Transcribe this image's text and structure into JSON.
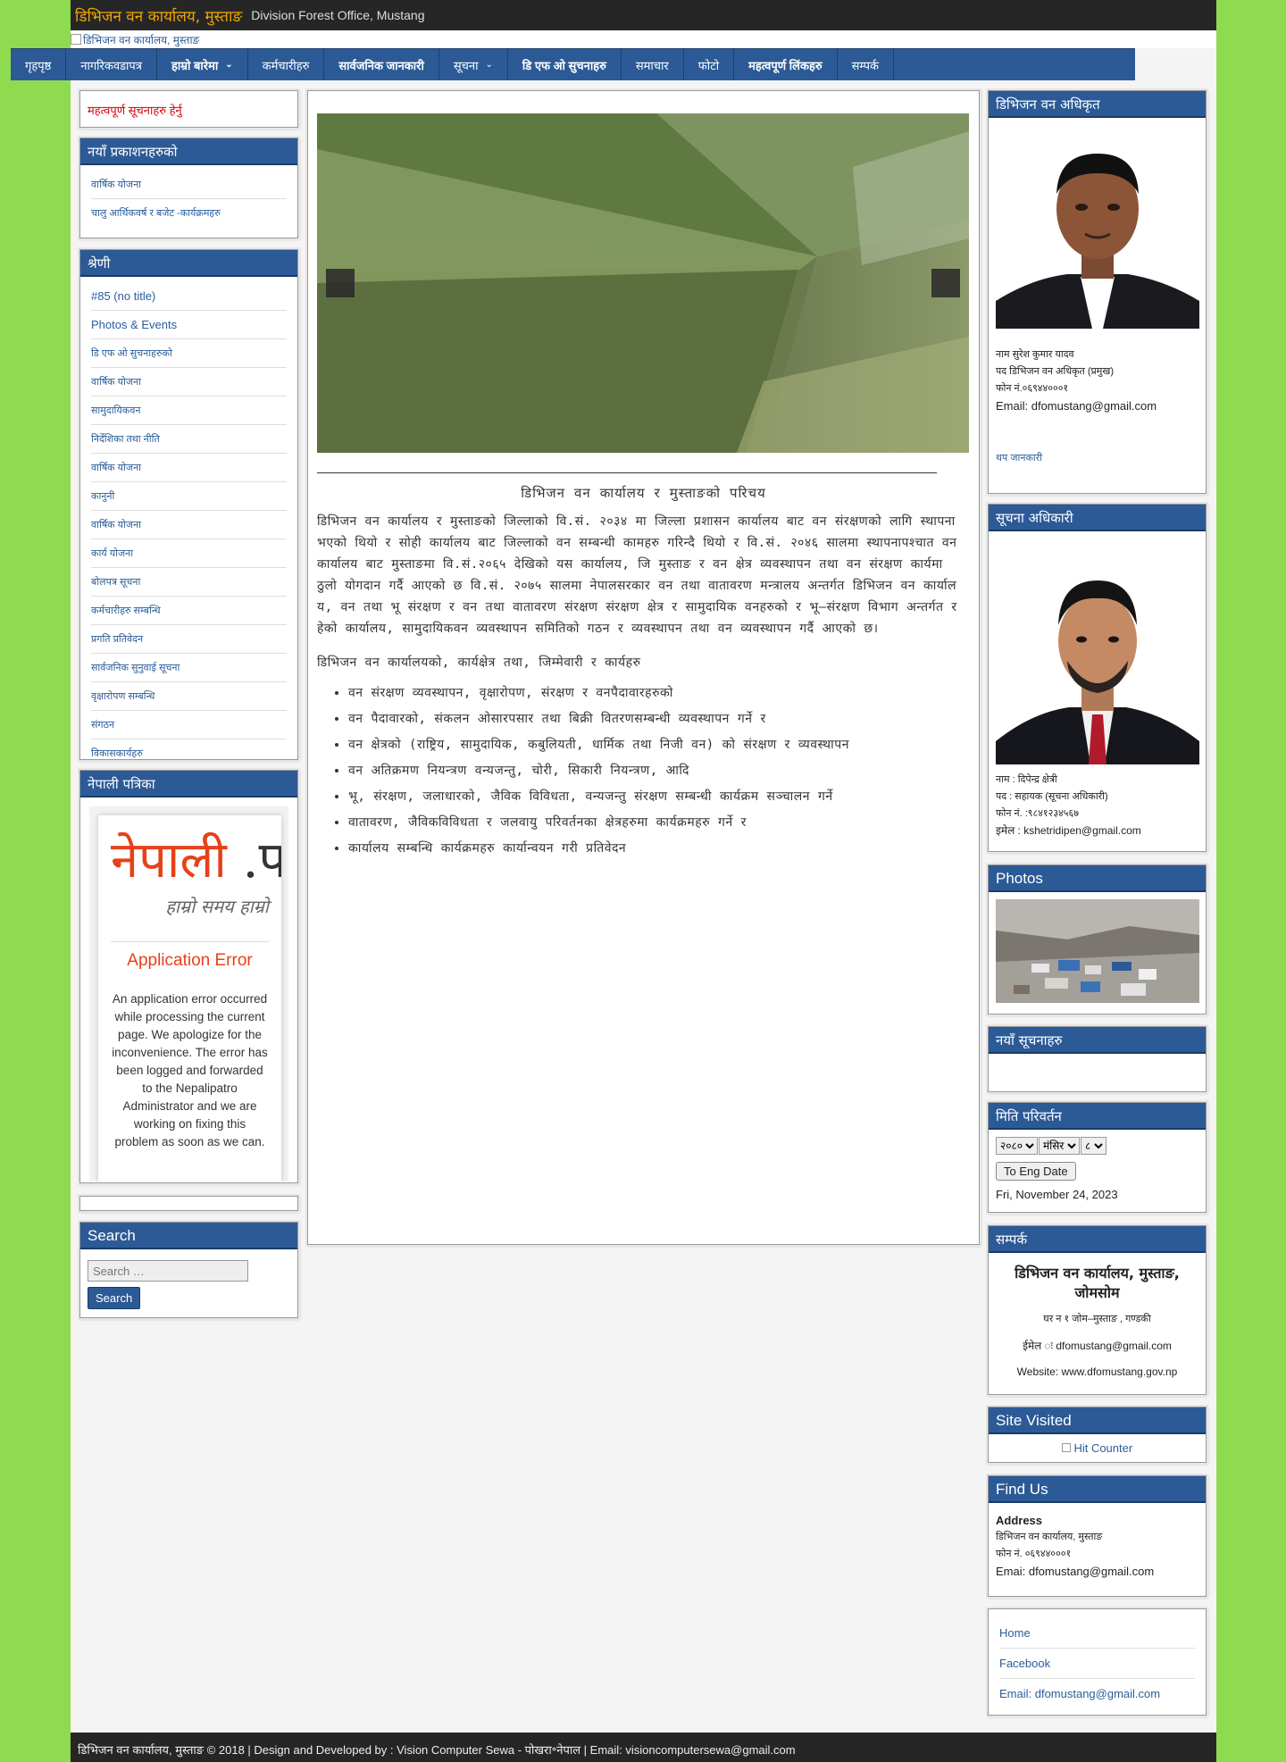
{
  "header": {
    "site_title": "डिभिजन वन कार्यालय, मुस्ताङ",
    "site_desc": "Division Forest Office, Mustang",
    "banner_alt": "डिभिजन वन कार्यालय, मुस्ताङ"
  },
  "nav": {
    "items": [
      {
        "label": "गृहपृष्ठ",
        "bold": false,
        "dropdown": false
      },
      {
        "label": "नागरिकवडापत्र",
        "bold": false,
        "dropdown": false
      },
      {
        "label": "हाम्रो बारेमा",
        "bold": true,
        "dropdown": true
      },
      {
        "label": "कर्मचारीहरु",
        "bold": false,
        "dropdown": false
      },
      {
        "label": "सार्वजनिक जानकारी",
        "bold": true,
        "dropdown": false
      },
      {
        "label": "सूचना",
        "bold": false,
        "dropdown": true
      },
      {
        "label": "डि एफ ओ सुचनाहरु",
        "bold": true,
        "dropdown": false
      },
      {
        "label": "समाचार",
        "bold": false,
        "dropdown": false
      },
      {
        "label": "फोटो",
        "bold": false,
        "dropdown": false
      },
      {
        "label": "महत्वपूर्ण लिंकहरु",
        "bold": true,
        "dropdown": false
      },
      {
        "label": "सम्पर्क",
        "bold": false,
        "dropdown": false
      }
    ]
  },
  "left": {
    "notice_link": "महत्वपूर्ण सूचनाहरु हेर्नु",
    "widget1": {
      "title": "नयाँ प्रकाशनहरुको",
      "items": [
        "वार्षिक योजना",
        "चालु आर्थिकवर्ष र बजेट  -कार्यक्रमहरु"
      ]
    },
    "widget2": {
      "title": "श्रेणी",
      "items": [
        "#85 (no title)",
        "Photos & Events",
        "डि एफ ओ सुचनाहरुको",
        "वार्षिक योजना",
        "सामुदायिकवन",
        "निर्देशिका तथा नीति",
        "वार्षिक योजना",
        "कानुनी",
        "वार्षिक योजना",
        "कार्य योजना",
        "बोलपत्र सूचना",
        "कर्मचारीहरु सम्बन्धि",
        "प्रगति प्रतिवेदन",
        "सार्वजनिक सुनुवाई सूचना",
        "वृक्षारोपण सम्बन्धि",
        "संगठन",
        "विकासकार्यहरु"
      ]
    },
    "widget3": {
      "title": "नेपाली पत्रिका",
      "logo_main": "नेपाली",
      "logo_dot": " .प",
      "logo_tagline": "हाम्रो समय हाम्रो",
      "error_title": "Application Error",
      "error_body": "An application error occurred while processing the current page. We apologize for the inconvenience. The error has been logged and forwarded to the Nepalipatro Administrator and we are working on fixing this problem as soon as we can."
    },
    "search": {
      "title": "Search",
      "placeholder": "Search …",
      "button": "Search"
    }
  },
  "main": {
    "article_title": "डिभिजन वन कार्यालय र मुस्ताङको परिचय",
    "paragraph": "डिभिजन वन कार्यालय र मुस्ताङको जिल्लाको वि.सं. २०३४ मा जिल्ला प्रशासन कार्यालय बाट वन संरक्षणको लागि स्थापना भएको थियो र सोही कार्यालय बाट जिल्लाको वन सम्बन्धी कामहरु गरिन्दै थियो र वि.सं. २०४६ सालमा स्थापनापश्चात वन कार्यालय बाट मुस्ताङमा वि.सं.२०६५ देखिको यस कार्यालय, जि मुस्ताङ र वन क्षेत्र व्यवस्थापन तथा वन संरक्षण कार्यमा ठुलो योगदान गर्दै आएको छ वि.सं. २०७५ सालमा नेपालसरकार वन तथा वातावरण मन्त्रालय अन्तर्गत डिभिजन वन कार्यालय, वन तथा भू संरक्षण र वन तथा वातावरण संरक्षण संरक्षण क्षेत्र र सामुदायिक वनहरुको र भू–संरक्षण विभाग अन्तर्गत रहेको कार्यालय, सामुदायिकवन व्यवस्थापन समितिको गठन र व्यवस्थापन तथा वन व्यवस्थापन गर्दै आएको छ।",
    "subheading": "डिभिजन वन कार्यालयको, कार्यक्षेत्र तथा, जिम्मेवारी र कार्यहरु",
    "bullets": [
      "वन संरक्षण व्यवस्थापन, वृक्षारोपण, संरक्षण र वनपैदावारहरुको",
      "वन पैदावारको, संकलन ओसारपसार तथा बिक्री वितरणसम्बन्धी व्यवस्थापन गर्ने र",
      "वन क्षेत्रको (राष्ट्रिय, सामुदायिक, कबुलियती, धार्मिक तथा निजी वन) को संरक्षण र व्यवस्थापन",
      "वन अतिक्रमण नियन्त्रण वन्यजन्तु, चोरी, सिकारी नियन्त्रण, आदि",
      "भू, संरक्षण, जलाधारको, जैविक विविधता, वन्यजन्तु संरक्षण सम्बन्धी कार्यक्रम सञ्चालन गर्ने",
      "वातावरण, जैविकविविधता र जलवायु परिवर्तनका क्षेत्रहरुमा कार्यक्रमहरु गर्ने र",
      "कार्यालय सम्बन्धि कार्यक्रमहरु कार्यान्वयन गरी प्रतिवेदन"
    ]
  },
  "right": {
    "officer": {
      "title": "डिभिजन वन अधिकृत",
      "name": "नाम सुरेश कुमार यादव",
      "post": "पद डिभिजन वन अधिकृत (प्रमुख)",
      "phone": "फोन नं.०६९४४०००१",
      "email": "Email: dfomustang@gmail.com",
      "more": "थप जानकारी"
    },
    "info_officer": {
      "title": "सूचना अधिकारी",
      "name": "नाम : दिपेन्द्र क्षेत्री",
      "post": "पद : सहायक (सूचना अधिकारी)",
      "phone": "फोन नं. :९८४१२३४५६७",
      "email": "इमेल : kshetridipen@gmail.com"
    },
    "photos_title": "Photos",
    "widget_empty_title": "नयाँ सूचनाहरु",
    "date_conv": {
      "title": "मिति परिवर्तन",
      "year": "२०८०",
      "month": "मंसिर",
      "day": "८",
      "button": "To Eng Date",
      "result": "Fri, November 24, 2023"
    },
    "contact": {
      "title": "सम्पर्क",
      "org": "डिभिजन वन कार्यालय, मुस्ताङ, जोमसोम",
      "addr": "घर न १ जोम–मुस्ताङ , गण्डकी",
      "email": "ईमेल ः  dfomustang@gmail.com",
      "website": "Website: www.dfomustang.gov.np"
    },
    "visited": {
      "title": "Site Visited",
      "alt": "Hit Counter"
    },
    "findus": {
      "title": "Find Us",
      "label": "Address",
      "line1": "डिभिजन वन कार्यालय, मुस्ताङ",
      "line2": "फोन नं. ०६९४४०००१",
      "line3": "Emai: dfomustang@gmail.com"
    },
    "links": [
      "Home",
      "Facebook",
      "Email: dfomustang@gmail.com"
    ]
  },
  "footer": {
    "text": "डिभिजन वन कार्यालय, मुस्ताङ © 2018 | Design and Developed by : Vision Computer Sewa - पोखरा॰नेपाल | Email: visioncomputersewa@gmail.com"
  },
  "colors": {
    "page_bg": "#8fdb4f",
    "nav_bg": "#2c5a96",
    "title_orange": "#f0a500",
    "notice_red": "#d9000d"
  }
}
